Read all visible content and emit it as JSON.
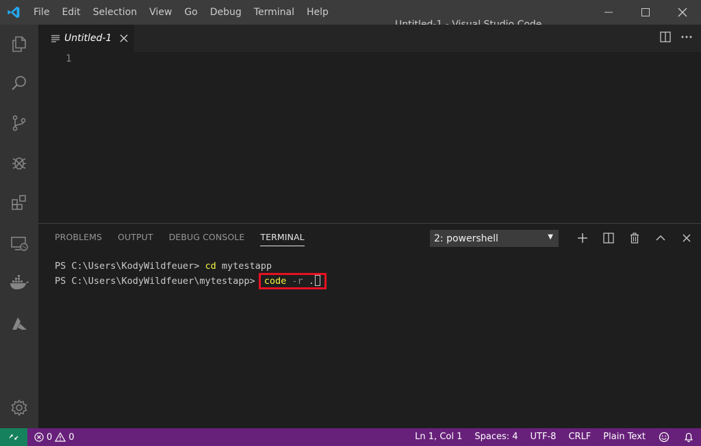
{
  "window": {
    "title": "Untitled-1 - Visual Studio Code",
    "menu": [
      "File",
      "Edit",
      "Selection",
      "View",
      "Go",
      "Debug",
      "Terminal",
      "Help"
    ]
  },
  "activity_bar": {
    "items": [
      "files-icon",
      "search-icon",
      "source-control-icon",
      "debug-icon",
      "extensions-icon",
      "remote-explorer-icon",
      "docker-icon",
      "azure-icon"
    ],
    "bottom": "gear-icon"
  },
  "editor": {
    "tab_label": "Untitled-1",
    "line_numbers": [
      "1"
    ]
  },
  "panel": {
    "tabs": [
      "PROBLEMS",
      "OUTPUT",
      "DEBUG CONSOLE",
      "TERMINAL"
    ],
    "active_tab": "TERMINAL",
    "terminal_select": "2: powershell",
    "terminal_lines": [
      {
        "prompt": "PS C:\\Users\\KodyWildfeuer> ",
        "cmd": "cd",
        "args": " mytestapp"
      },
      {
        "prompt": "PS C:\\Users\\KodyWildfeuer\\mytestapp> ",
        "cmd": "code",
        "flag": " -r ",
        "arg": "."
      }
    ]
  },
  "status_bar": {
    "errors": "0",
    "warnings": "0",
    "position": "Ln 1, Col 1",
    "spaces": "Spaces: 4",
    "encoding": "UTF-8",
    "eol": "CRLF",
    "language": "Plain Text"
  },
  "colors": {
    "status_bar": "#68217a",
    "remote_indicator": "#16825d",
    "highlight_box": "#e81123",
    "vscode_blue": "#23a9f2"
  }
}
